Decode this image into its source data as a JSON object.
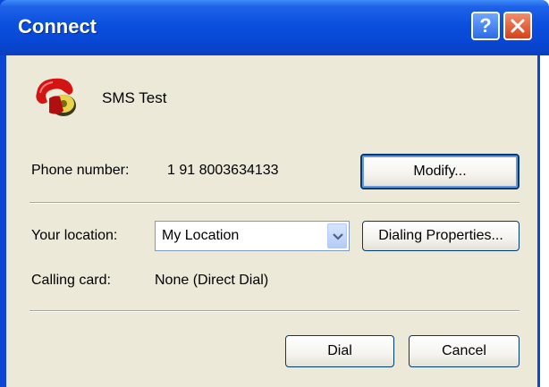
{
  "window": {
    "title": "Connect",
    "help_label": "?",
    "entry_name": "SMS Test"
  },
  "phone": {
    "label": "Phone number:",
    "value": "1 91 8003634133",
    "modify_button": "Modify..."
  },
  "location": {
    "label": "Your location:",
    "selected": "My Location",
    "dialing_properties_button": "Dialing Properties..."
  },
  "calling_card": {
    "label": "Calling card:",
    "value": "None (Direct Dial)"
  },
  "actions": {
    "dial_button": "Dial",
    "cancel_button": "Cancel"
  },
  "colors": {
    "titlebar": "#0a4fdd",
    "dialog_bg": "#ece9d8",
    "close_button": "#d5421a"
  },
  "icons": {
    "entry_icon": "red-telephone-icon",
    "help": "help-icon",
    "close": "close-icon",
    "dropdown": "chevron-down-icon"
  }
}
